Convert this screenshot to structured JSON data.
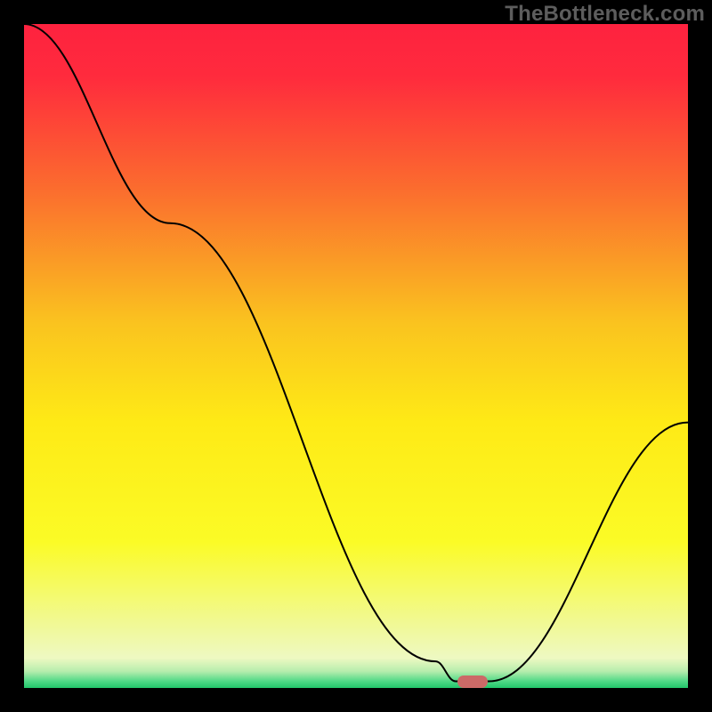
{
  "watermark": "TheBottleneck.com",
  "chart_data": {
    "type": "line",
    "title": "",
    "xlabel": "",
    "ylabel": "",
    "xlim": [
      0,
      100
    ],
    "ylim": [
      0,
      100
    ],
    "series": [
      {
        "name": "curve",
        "x": [
          0,
          22,
          62,
          65,
          70,
          100
        ],
        "values": [
          100,
          70,
          4,
          1,
          1,
          40
        ]
      }
    ],
    "marker": {
      "x": 67.5,
      "y": 1
    },
    "gradient_stops": [
      {
        "pos": 0.0,
        "color": "#fe223f"
      },
      {
        "pos": 0.08,
        "color": "#ff2b3d"
      },
      {
        "pos": 0.25,
        "color": "#fb6d2e"
      },
      {
        "pos": 0.45,
        "color": "#fac31f"
      },
      {
        "pos": 0.6,
        "color": "#feea16"
      },
      {
        "pos": 0.78,
        "color": "#fbfb26"
      },
      {
        "pos": 0.9,
        "color": "#f1f992"
      },
      {
        "pos": 0.955,
        "color": "#eef9c2"
      },
      {
        "pos": 0.975,
        "color": "#b6edad"
      },
      {
        "pos": 0.99,
        "color": "#4fd886"
      },
      {
        "pos": 1.0,
        "color": "#22c56a"
      }
    ]
  }
}
